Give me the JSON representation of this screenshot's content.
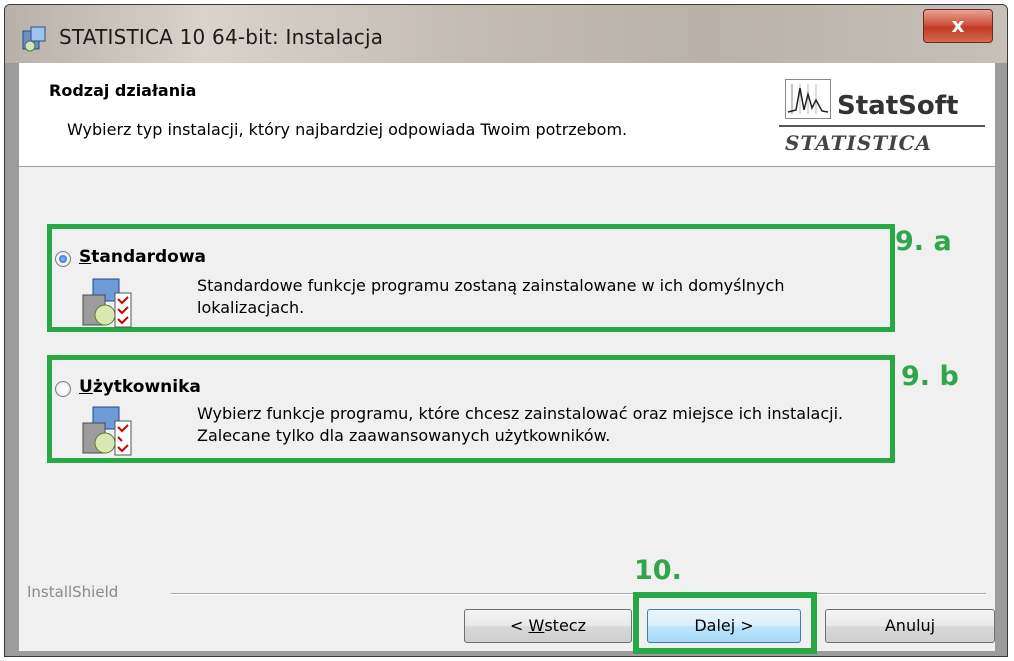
{
  "window": {
    "title": "STATISTICA 10 64-bit: Instalacja",
    "close_label": "x"
  },
  "header": {
    "title": "Rodzaj działania",
    "subtitle": "Wybierz typ instalacji, który najbardziej odpowiada Twoim potrzebom.",
    "logo_brand": "StatSoft",
    "logo_product": "STATISTICA"
  },
  "options": [
    {
      "label_mnemonic": "S",
      "label_rest": "tandardowa",
      "selected": true,
      "description": "Standardowe funkcje programu zostaną zainstalowane w ich domyślnych lokalizacjach.",
      "annotation": "9. a"
    },
    {
      "label_mnemonic": "U",
      "label_rest": "żytkownika",
      "selected": false,
      "description": "Wybierz funkcje programu, które chcesz zainstalować oraz miejsce ich instalacji. Zalecane tylko dla zaawansowanych użytkowników.",
      "annotation": "9. b"
    }
  ],
  "footer": {
    "brand": "InstallShield",
    "annotation": "10.",
    "back_prefix": "< ",
    "back_mnemonic": "W",
    "back_rest": "stecz",
    "next_label": "Dalej >",
    "cancel_label": "Anuluj"
  },
  "colors": {
    "annotation_green": "#27a844",
    "dialog_bg": "#f0f0f0"
  }
}
